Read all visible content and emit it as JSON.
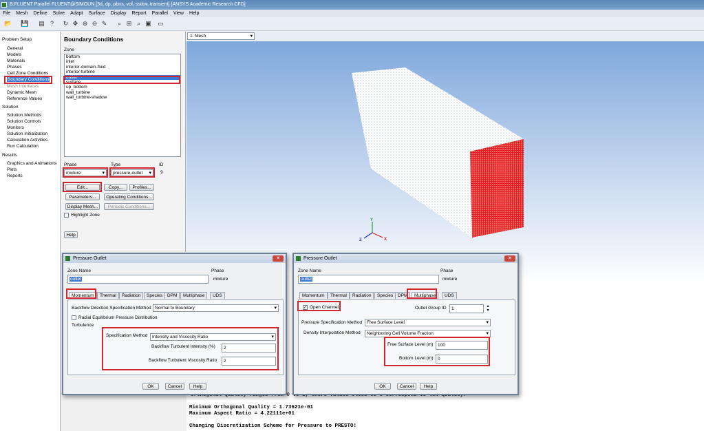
{
  "window": {
    "title": "B:FLUENT Parallel FLUENT@SIMOUN  [3d, dp, pbns, vof, sstkw, transient] [ANSYS Academic Research CFD]"
  },
  "menu": [
    "File",
    "Mesh",
    "Define",
    "Solve",
    "Adapt",
    "Surface",
    "Display",
    "Report",
    "Parallel",
    "View",
    "Help"
  ],
  "toolbar_icons": [
    "open-icon",
    "save-icon",
    "print-icon",
    "help-icon",
    "rotate-icon",
    "pan-icon",
    "zoom-in-icon",
    "zoom-out-icon",
    "probe-icon",
    "fit-icon",
    "zoom-box-icon",
    "zoom-icon",
    "view-icon",
    "window-icon"
  ],
  "tree": {
    "problem_setup": "Problem Setup",
    "setup_items": [
      "General",
      "Models",
      "Materials",
      "Phases",
      "Cell Zone Conditions",
      "Boundary Conditions",
      "Mesh Interfaces",
      "Dynamic Mesh",
      "Reference Values"
    ],
    "solution": "Solution",
    "solution_items": [
      "Solution Methods",
      "Solution Controls",
      "Monitors",
      "Solution Initialization",
      "Calculation Activities",
      "Run Calculation"
    ],
    "results": "Results",
    "results_items": [
      "Graphics and Animations",
      "Plots",
      "Reports"
    ]
  },
  "bc_panel": {
    "title": "Boundary Conditions",
    "zone_label": "Zone",
    "zones": [
      "bottom",
      "inlet",
      "interior-domain-fluid",
      "interior-turbine",
      "outlet",
      "surface",
      "up_bottom",
      "wall_turbine",
      "wall_turbine-shadow"
    ],
    "selected_zone": "outlet",
    "phase_label": "Phase",
    "phase_value": "mixture",
    "type_label": "Type",
    "type_value": "pressure-outlet",
    "id_label": "ID",
    "id_value": "9",
    "buttons": {
      "edit": "Edit...",
      "copy": "Copy...",
      "profiles": "Profiles...",
      "parameters": "Parameters...",
      "operating": "Operating Conditions...",
      "display_mesh": "Display Mesh...",
      "periodic": "Periodic Conditions...",
      "help": "Help"
    },
    "highlight_zone": "Highlight Zone"
  },
  "viewport": {
    "selector": "1: Mesh",
    "axes": {
      "x": "X",
      "y": "Y",
      "z": "Z"
    }
  },
  "console": {
    "line1": "Orthogonal Quality ranges from 0 to 1, where values close to 0 correspond to low quality.",
    "line2": "Minimum Orthogonal Quality =  1.73621e-01",
    "line3": "Maximum Aspect Ratio =  4.22111e+01",
    "line4": "Changing Discretization Scheme for Pressure to PRESTO!"
  },
  "dialog_left": {
    "title": "Pressure Outlet",
    "zone_name_label": "Zone Name",
    "zone_name": "outlet",
    "phase_label": "Phase",
    "phase": "mixture",
    "tabs": [
      "Momentum",
      "Thermal",
      "Radiation",
      "Species",
      "DPM",
      "Multiphase",
      "UDS"
    ],
    "active_tab": "Momentum",
    "backflow_label": "Backflow Direction Specification Method",
    "backflow_value": "Normal to Boundary",
    "radial_eq": "Radial Equilibrium Pressure Distribution",
    "turbulence": "Turbulence",
    "spec_method_label": "Specification Method",
    "spec_method_value": "Intensity and Viscosity Ratio",
    "intensity_label": "Backflow Turbulent Intensity (%)",
    "intensity_value": "2",
    "viscosity_label": "Backflow Turbulent Viscosity Ratio",
    "viscosity_value": "2",
    "ok": "OK",
    "cancel": "Cancel",
    "help": "Help"
  },
  "dialog_right": {
    "title": "Pressure Outlet",
    "zone_name_label": "Zone Name",
    "zone_name": "outlet",
    "phase_label": "Phase",
    "phase": "mixture",
    "tabs": [
      "Momentum",
      "Thermal",
      "Radiation",
      "Species",
      "DPM",
      "Multiphase",
      "UDS"
    ],
    "active_tab": "Multiphase",
    "open_channel": "Open Channel",
    "outlet_group_label": "Outlet Group ID",
    "outlet_group_value": "1",
    "pressure_spec_label": "Pressure Specification Method",
    "pressure_spec_value": "Free Surface Level",
    "density_label": "Density Interpolation Method",
    "density_value": "Neighboring Cell Volume Fraction",
    "free_surface_label": "Free Surface Level (m)",
    "free_surface_value": "100",
    "bottom_level_label": "Bottom Level (m)",
    "bottom_level_value": "0",
    "ok": "OK",
    "cancel": "Cancel",
    "help": "Help"
  },
  "colors": {
    "highlight": "#d1262d",
    "selection": "#3f78d1",
    "outlet_face": "#e02020"
  }
}
